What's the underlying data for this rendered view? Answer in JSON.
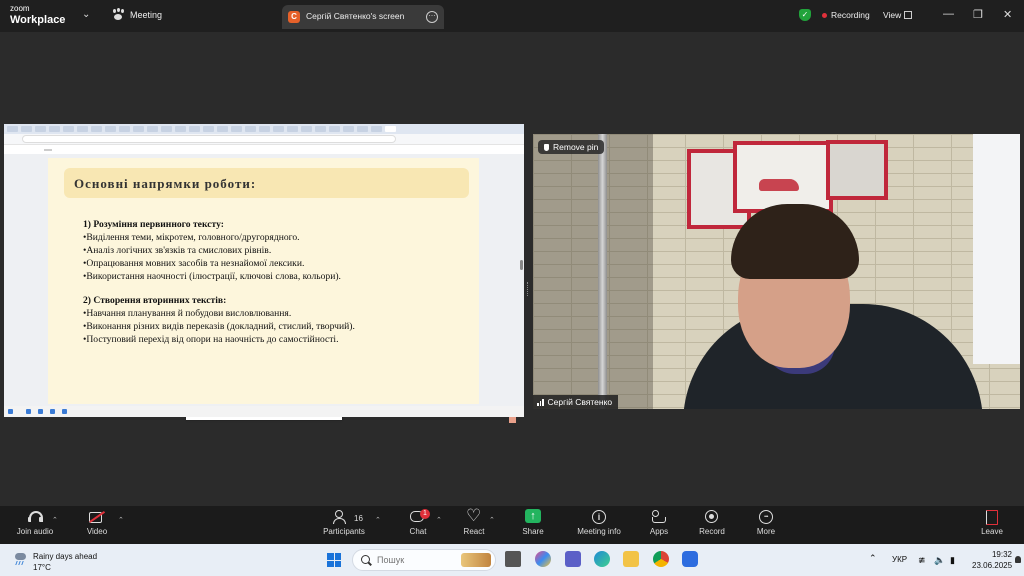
{
  "topbar": {
    "brand_line1": "zoom",
    "brand_line2": "Workplace",
    "meeting_label": "Meeting",
    "share_badge": "C",
    "share_title": "Сергій Святенко's screen",
    "recording_label": "Recording",
    "view_label": "View",
    "icons": [
      "chevron-down-icon",
      "paw-icon",
      "shield-check-icon",
      "window-controls"
    ]
  },
  "shared_screen": {
    "slide": {
      "title": "Основні напрямки роботи:",
      "section1_heading": "1) Розуміння первинного тексту:",
      "section1_items": [
        "•Виділення теми, мікротем, головного/другорядного.",
        "•Аналіз логічних зв'язків та смислових рівнів.",
        "•Опрацювання мовних засобів та незнайомої лексики.",
        "•Використання наочності (ілюстрації, ключові слова, кольори)."
      ],
      "section2_heading": "2) Створення вторинних текстів:",
      "section2_items": [
        "•Навчання планування й побудови висловлювання.",
        "•Виконання різних видів переказів (докладний, стислий, творчий).",
        "•Поступовий перехід від опори на наочність до самостійності."
      ]
    }
  },
  "video": {
    "remove_pin_label": "Remove pin",
    "participant_name": "Сергій Святенко"
  },
  "toolbar": {
    "join_audio": "Join audio",
    "video": "Video",
    "participants": "Participants",
    "participants_count": "16",
    "chat": "Chat",
    "chat_badge": "1",
    "react": "React",
    "share": "Share",
    "meeting_info": "Meeting info",
    "apps": "Apps",
    "record": "Record",
    "more": "More",
    "leave": "Leave",
    "share_color": "#23b45f",
    "leave_color": "#e0303a"
  },
  "taskbar": {
    "weather_title": "Rainy days ahead",
    "weather_temp": "17°C",
    "search_placeholder": "Пошук",
    "language": "УКР",
    "time": "19:32",
    "date": "23.06.2025"
  }
}
